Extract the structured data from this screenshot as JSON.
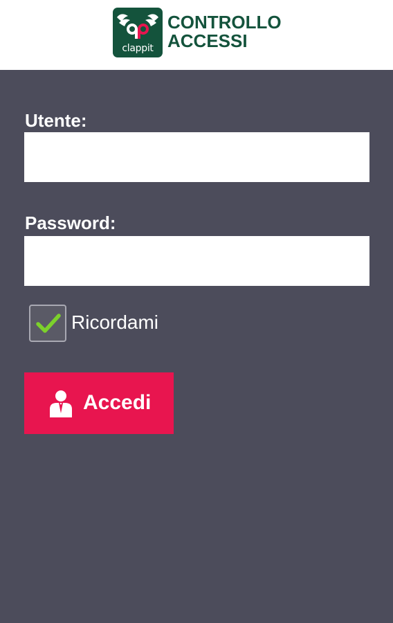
{
  "header": {
    "logo_word": "clappit",
    "title_line1": "CONTROLLO",
    "title_line2": "ACCESSI"
  },
  "form": {
    "user_label": "Utente:",
    "user_value": "",
    "password_label": "Password:",
    "password_value": "",
    "remember_label": "Ricordami",
    "remember_checked": true,
    "submit_label": "Accedi"
  },
  "icons": {
    "logo": "clappit-logo-icon",
    "check": "checkmark-icon",
    "user": "user-icon"
  },
  "colors": {
    "background": "#4c4c5b",
    "header": "#ffffff",
    "brand_green": "#14533c",
    "accent": "#e8154f",
    "check_green": "#7cd12b"
  }
}
